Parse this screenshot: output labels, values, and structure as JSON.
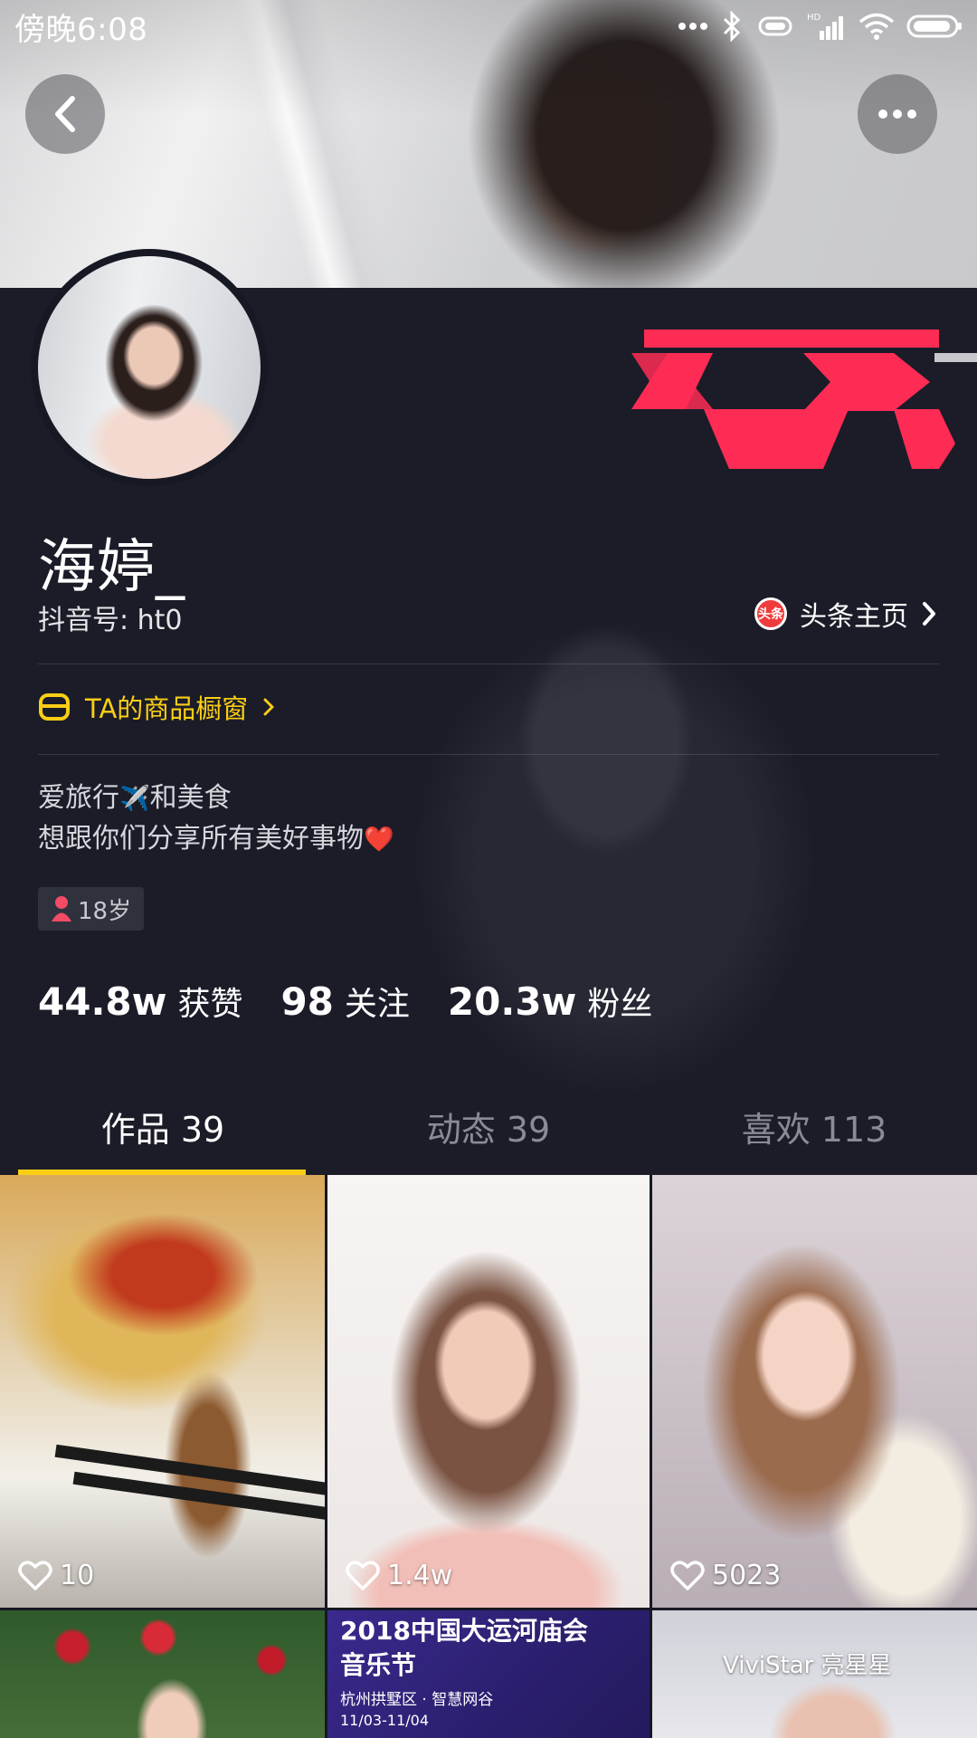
{
  "status_bar": {
    "time": "傍晚6:08",
    "icons": [
      "more-dots-icon",
      "bluetooth-icon",
      "vibrate-icon",
      "hd-signal-icon",
      "wifi-icon",
      "battery-icon"
    ]
  },
  "header": {
    "back_icon": "chevron-left-icon",
    "more_icon": "more-horizontal-icon"
  },
  "profile": {
    "name": "海婷_",
    "douyin_id": "抖音号: ht0",
    "toutiao_badge": "头条",
    "toutiao_link": "头条主页",
    "shop_link": "TA的商品橱窗",
    "bio_line1_a": "爱旅行",
    "bio_emoji1": "✈️",
    "bio_line1_b": "和美食",
    "bio_line2": "想跟你们分享所有美好事物",
    "bio_emoji2": "❤️",
    "age": "18岁",
    "accent_color": "#face15"
  },
  "stats": [
    {
      "num": "44.8w",
      "label": "获赞"
    },
    {
      "num": "98",
      "label": "关注"
    },
    {
      "num": "20.3w",
      "label": "粉丝"
    }
  ],
  "tabs": [
    {
      "label": "作品 39",
      "active": true
    },
    {
      "label": "动态 39",
      "active": false
    },
    {
      "label": "喜欢 113",
      "active": false
    }
  ],
  "grid": {
    "tiles": [
      {
        "likes": "10"
      },
      {
        "likes": "1.4w"
      },
      {
        "likes": "5023"
      }
    ],
    "tile5_title1": "2018中国大运河庙会",
    "tile5_title2": "音乐节",
    "tile5_sub": "杭州拱墅区 · 智慧网谷",
    "tile5_date": "11/03-11/04",
    "tile6_label": "ViviStar 亮星星"
  }
}
